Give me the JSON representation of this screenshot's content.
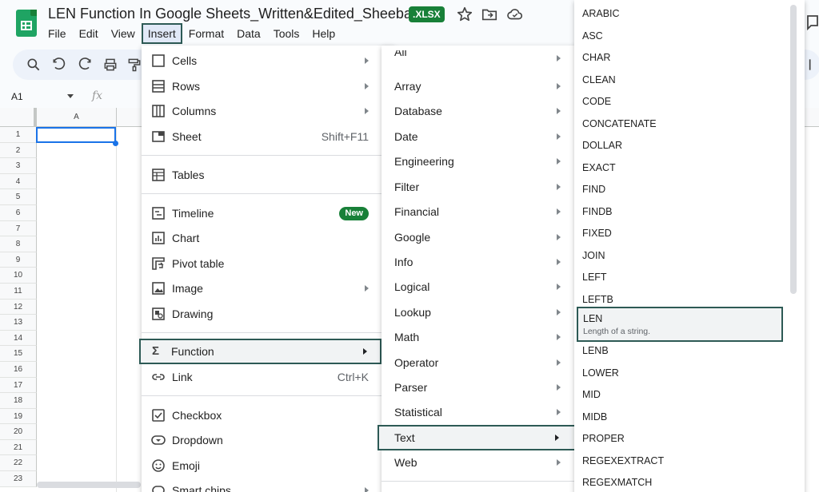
{
  "app": {
    "doc_title": "LEN Function In Google Sheets_Written&Edited_Sheeba",
    "format_badge": ".XLSX",
    "icons": [
      "star-icon",
      "move-to-folder-icon",
      "cloud-status-icon"
    ]
  },
  "menubar": [
    "File",
    "Edit",
    "View",
    "Insert",
    "Format",
    "Data",
    "Tools",
    "Help"
  ],
  "formula_bar": {
    "namebox": "A1",
    "fx": "fx"
  },
  "grid": {
    "column_header": "A",
    "row_numbers": [
      "1",
      "2",
      "3",
      "4",
      "5",
      "6",
      "7",
      "8",
      "9",
      "10",
      "11",
      "12",
      "13",
      "14",
      "15",
      "16",
      "17",
      "18",
      "19",
      "20",
      "21",
      "22",
      "23"
    ]
  },
  "insert_menu": {
    "items": [
      {
        "label": "Cells",
        "icon": "square-icon",
        "submenu": true
      },
      {
        "label": "Rows",
        "icon": "rows-icon",
        "submenu": true
      },
      {
        "label": "Columns",
        "icon": "columns-icon",
        "submenu": true
      },
      {
        "label": "Sheet",
        "icon": "sheet-icon",
        "shortcut": "Shift+F11"
      },
      {
        "label": "Tables",
        "icon": "table-icon"
      },
      {
        "label": "Timeline",
        "icon": "timeline-icon",
        "badge": "New"
      },
      {
        "label": "Chart",
        "icon": "chart-icon"
      },
      {
        "label": "Pivot table",
        "icon": "pivot-table-icon"
      },
      {
        "label": "Image",
        "icon": "image-icon",
        "submenu": true
      },
      {
        "label": "Drawing",
        "icon": "drawing-icon"
      },
      {
        "label": "Function",
        "icon": "sigma-icon",
        "submenu": true,
        "highlighted": true
      },
      {
        "label": "Link",
        "icon": "link-icon",
        "shortcut": "Ctrl+K"
      },
      {
        "label": "Checkbox",
        "icon": "checkbox-icon"
      },
      {
        "label": "Dropdown",
        "icon": "dropdown-icon"
      },
      {
        "label": "Emoji",
        "icon": "emoji-icon"
      },
      {
        "label": "Smart chips",
        "icon": "smart-chip-icon",
        "submenu": true
      }
    ]
  },
  "function_menu": {
    "items": [
      "All",
      "Array",
      "Database",
      "Date",
      "Engineering",
      "Filter",
      "Financial",
      "Google",
      "Info",
      "Logical",
      "Lookup",
      "Math",
      "Operator",
      "Parser",
      "Statistical",
      "Text",
      "Web"
    ],
    "highlighted": "Text"
  },
  "text_menu": {
    "items_before": [
      "ARABIC",
      "ASC",
      "CHAR",
      "CLEAN",
      "CODE",
      "CONCATENATE",
      "DOLLAR",
      "EXACT",
      "FIND",
      "FINDB",
      "FIXED",
      "JOIN",
      "LEFT",
      "LEFTB"
    ],
    "highlighted": {
      "label": "LEN",
      "description": "Length of a string."
    },
    "items_after": [
      "LENB",
      "LOWER",
      "MID",
      "MIDB",
      "PROPER",
      "REGEXEXTRACT",
      "REGEXMATCH"
    ]
  },
  "colors": {
    "accent": "#188038",
    "highlight_border": "#2d5a55",
    "selection": "#1a73e8"
  }
}
